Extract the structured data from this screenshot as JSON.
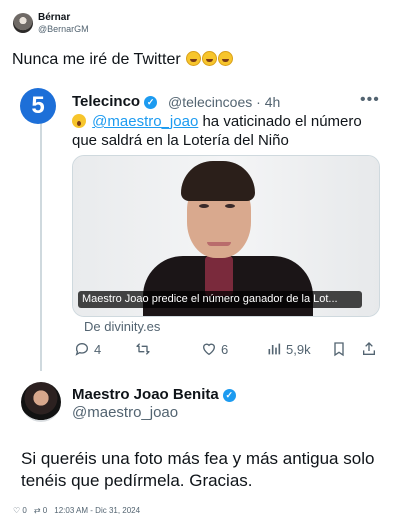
{
  "post": {
    "author_name": "Bérnar",
    "author_handle": "@BernarGM",
    "text": "Nunca me iré de Twitter",
    "emoji_names": [
      "rofl-emoji",
      "rofl-emoji",
      "rofl-emoji"
    ]
  },
  "quoted": {
    "logo_text": "5",
    "name": "Telecinco",
    "handle_time": "@telecincoes · 4h",
    "mention": "@maestro_joao",
    "text_rest": " ha vaticinado el número que saldrá en la Lotería del Niño",
    "media_caption": "Maestro Joao predice el número ganador de la Lot...",
    "source": "De divinity.es",
    "actions": {
      "replies": "4",
      "likes": "6",
      "views": "5,9k"
    }
  },
  "reply": {
    "name": "Maestro Joao Benita",
    "handle": "@maestro_joao",
    "text": "Si queréis una foto más fea y más antigua solo tenéis que pedírmela. Gracias."
  },
  "footer": {
    "likes": "0",
    "retweets": "0",
    "timestamp": "12:03 AM - Dic 31, 2024"
  },
  "colors": {
    "accent": "#1d9bf0",
    "muted": "#536471",
    "text": "#0f1419"
  }
}
